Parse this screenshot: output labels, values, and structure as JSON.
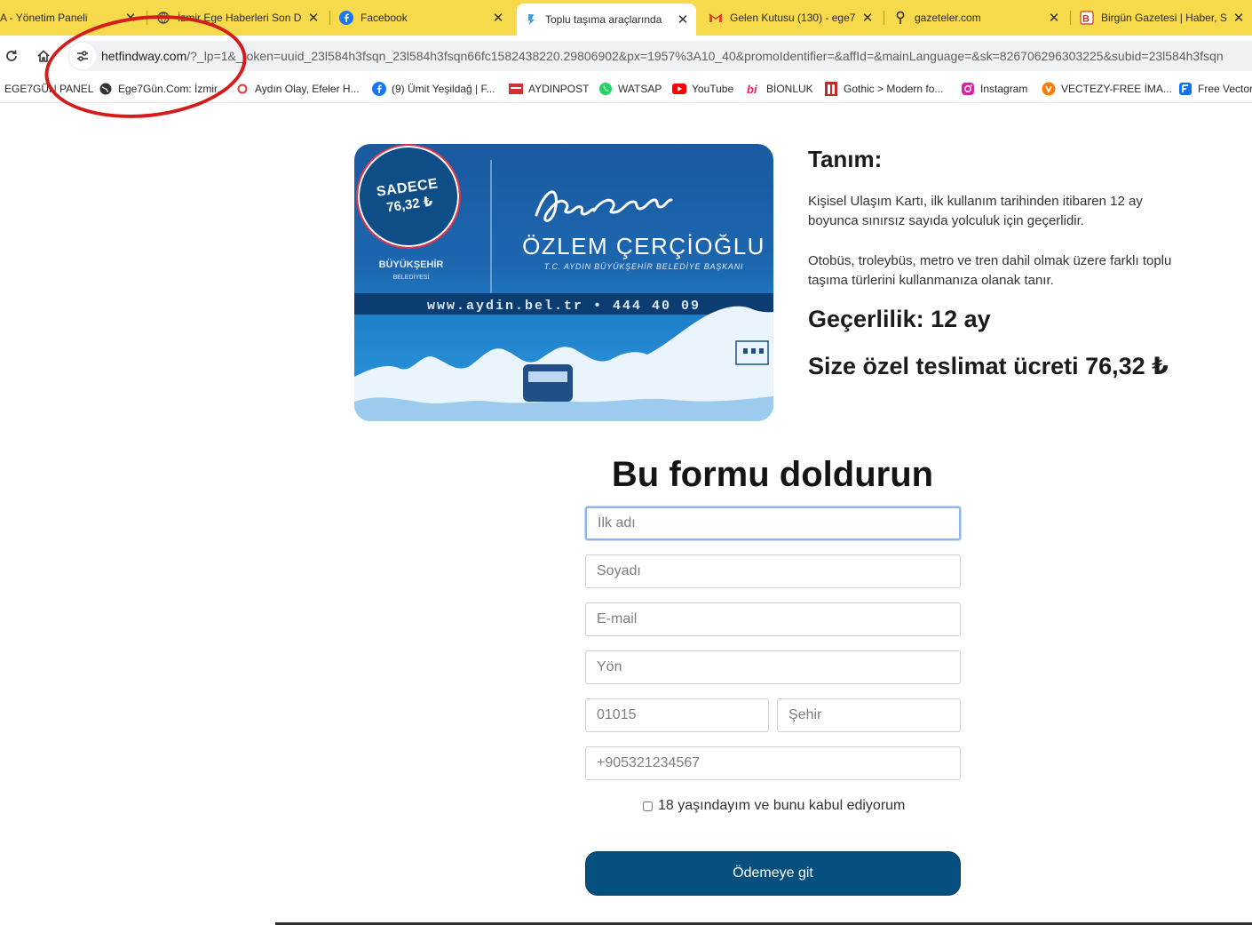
{
  "browser": {
    "tabs": [
      {
        "title": "A - Yönetim Paneli",
        "icon": "globe-icon",
        "active": false
      },
      {
        "title": "İzmir Ege Haberleri Son D",
        "icon": "globe-icon",
        "active": false
      },
      {
        "title": "Facebook",
        "icon": "facebook-icon",
        "active": false
      },
      {
        "title": "Toplu taşıma araçlarında",
        "icon": "page-icon",
        "active": true
      },
      {
        "title": "Gelen Kutusu (130) - ege7",
        "icon": "gmail-icon",
        "active": false
      },
      {
        "title": "gazeteler.com",
        "icon": "location-pin-icon",
        "active": false
      },
      {
        "title": "Birgün Gazetesi | Haber, S",
        "icon": "birgun-icon",
        "active": false
      }
    ],
    "tab_close_glyph": "✕",
    "address_bar": {
      "host": "hetfindway.com",
      "path": "/?_lp=1&_token=uuid_23l584h3fsqn_23l584h3fsqn66fc1582438220.29806902&px=1957%3A10_40&promoIdentifier=&affId=&mainLanguage=&sk=826706296303225&subid=23l584h3fsqn"
    },
    "bookmarks": [
      {
        "label": "EGE7GÜN PANEL",
        "icon": "none"
      },
      {
        "label": "Ege7Gün.Com: İzmir...",
        "icon": "globe-icon"
      },
      {
        "label": "Aydın Olay, Efeler H...",
        "icon": "aydin-olay-icon"
      },
      {
        "label": "(9) Ümit Yeşildağ | F...",
        "icon": "facebook-icon"
      },
      {
        "label": "AYDINPOST",
        "icon": "aydinpost-icon"
      },
      {
        "label": "WATSAP",
        "icon": "whatsapp-icon"
      },
      {
        "label": "YouTube",
        "icon": "youtube-icon"
      },
      {
        "label": "BİONLUK",
        "icon": "bionluk-icon"
      },
      {
        "label": "Gothic > Modern fo...",
        "icon": "gothic-icon"
      },
      {
        "label": "Instagram",
        "icon": "instagram-icon"
      },
      {
        "label": "VECTEZY-FREE İMA...",
        "icon": "vecteezy-icon"
      },
      {
        "label": "Free Vector",
        "icon": "freepik-icon"
      }
    ]
  },
  "page": {
    "card": {
      "badge_line1": "SADECE",
      "badge_line2": "76,32 ₺",
      "name": "ÖZLEM ÇERÇİOĞLU",
      "subtitle": "T.C. AYDIN BÜYÜKŞEHİR BELEDİYE BAŞKANI",
      "footer": "www.aydin.bel.tr • 444 40 09",
      "logo_text": "BÜYÜKŞEHİR",
      "logo_subtext": "BELEDİYESİ",
      "colors": {
        "card_blue": "#1a5aa0",
        "badge_blue": "#0f4d86",
        "badge_ring": "#e2334b"
      }
    },
    "description": {
      "heading": "Tanım:",
      "paragraph1": "Kişisel Ulaşım Kartı, ilk kullanım tarihinden itibaren 12 ay boyunca sınırsız sayıda yolculuk için geçerlidir.",
      "paragraph2": "Otobüs, troleybüs, metro ve tren dahil olmak üzere farklı toplu taşıma türlerini kullanmanıza olanak tanır.",
      "validity": "Geçerlilik: 12 ay",
      "delivery_fee": "Size özel teslimat ücreti 76,32 ₺"
    },
    "form": {
      "title": "Bu formu doldurun",
      "first_name": {
        "placeholder": "İlk adı",
        "value": ""
      },
      "last_name": {
        "placeholder": "Soyadı",
        "value": ""
      },
      "email": {
        "placeholder": "E-mail",
        "value": ""
      },
      "address": {
        "placeholder": "Yön",
        "value": ""
      },
      "postal_code": {
        "placeholder": "01015",
        "value": ""
      },
      "city": {
        "placeholder": "Şehir",
        "value": ""
      },
      "phone": {
        "placeholder": "+905321234567",
        "value": ""
      },
      "consent_label": "18 yaşındayım ve bunu kabul ediyorum",
      "consent_checked": false,
      "submit_label": "Ödemeye git",
      "submit_color": "#06507f"
    }
  },
  "annotation": {
    "color": "#d41c1c",
    "shape": "ellipse"
  }
}
